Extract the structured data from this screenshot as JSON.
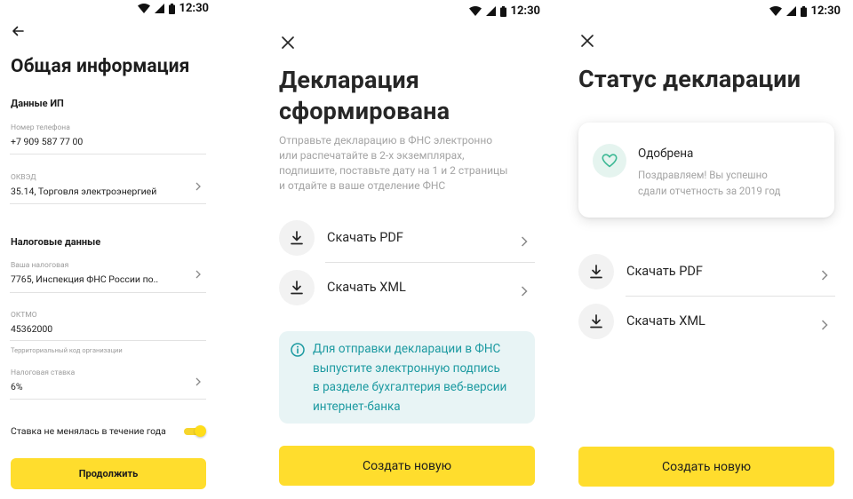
{
  "status_bar": {
    "time": "12:30"
  },
  "screen1": {
    "title": "Общая информация",
    "section_ip": "Данные ИП",
    "phone": {
      "label": "Номер телефона",
      "value": "+7 909 587 77 00"
    },
    "okved": {
      "label": "ОКВЭД",
      "value": "35.14, Торговля электроэнергией"
    },
    "section_tax": "Налоговые данные",
    "tax_office": {
      "label": "Ваша налоговая",
      "value": "7765, Инспекция ФНС России по.."
    },
    "oktmo": {
      "label": "ОКТМО",
      "value": "45362000",
      "hint": "Территориальный код организации"
    },
    "tax_rate": {
      "label": "Налоговая ставка",
      "value": "6%"
    },
    "toggle_label": "Ставка не менялась в течение года",
    "toggle_on": true,
    "continue_button": "Продолжить"
  },
  "screen2": {
    "title_line1": "Декларация",
    "title_line2": "сформирована",
    "desc_lines": [
      "Отправьте декларацию в ФНС электронно",
      "или распечатайте в 2-х экземплярах,",
      "подпишите, поставьте дату на 1 и 2 страницы",
      "и отдайте в ваше отделение ФНС"
    ],
    "download_pdf": "Скачать PDF",
    "download_xml": "Скачать XML",
    "info_lines": [
      "Для отправки декларации в ФНС",
      "выпустите электронную подпись",
      "в разделе бухгалтерия веб-версии",
      "интернет-банка"
    ],
    "create_button": "Создать новую"
  },
  "screen3": {
    "title": "Статус декларации",
    "status_title": "Одобрена",
    "status_text_line1": "Поздравляем! Вы успешно",
    "status_text_line2": "сдали отчетность за 2019 год",
    "download_pdf": "Скачать PDF",
    "download_xml": "Скачать XML",
    "create_button": "Создать новую"
  },
  "colors": {
    "accent_yellow": "#ffdd2d",
    "info_bg": "#e8f4f5",
    "info_text": "#1c9aa1",
    "success_icon": "#3cb894"
  },
  "icons": [
    "back-arrow-icon",
    "close-icon",
    "chevron-right-icon",
    "download-icon",
    "info-icon",
    "heart-icon",
    "wifi-icon",
    "signal-icon",
    "battery-icon"
  ]
}
